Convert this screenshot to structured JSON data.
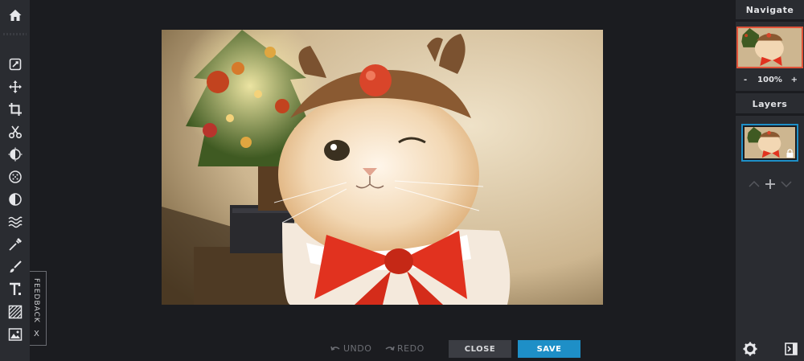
{
  "toolbar": {
    "tools": [
      {
        "name": "home-icon"
      },
      {
        "name": "adjust-icon"
      },
      {
        "name": "move-icon"
      },
      {
        "name": "crop-icon"
      },
      {
        "name": "scissors-icon"
      },
      {
        "name": "enhance-icon"
      },
      {
        "name": "texture-icon"
      },
      {
        "name": "contrast-icon"
      },
      {
        "name": "waves-icon"
      },
      {
        "name": "dropper-icon"
      },
      {
        "name": "brush-icon"
      },
      {
        "name": "text-icon"
      },
      {
        "name": "hatch-icon"
      },
      {
        "name": "image-icon"
      }
    ]
  },
  "feedback": {
    "label": "FEEDBACK",
    "close": "X"
  },
  "bottom": {
    "undo": "UNDO",
    "redo": "REDO",
    "close": "CLOSE",
    "save": "SAVE"
  },
  "navigate": {
    "title": "Navigate",
    "zoom": "100%",
    "zoom_minus": "-",
    "zoom_plus": "+"
  },
  "layers": {
    "title": "Layers"
  },
  "colors": {
    "accent": "#1e8fc7",
    "nav_border": "#e0533a",
    "panel": "#2a2c31",
    "bg": "#1b1c20"
  }
}
